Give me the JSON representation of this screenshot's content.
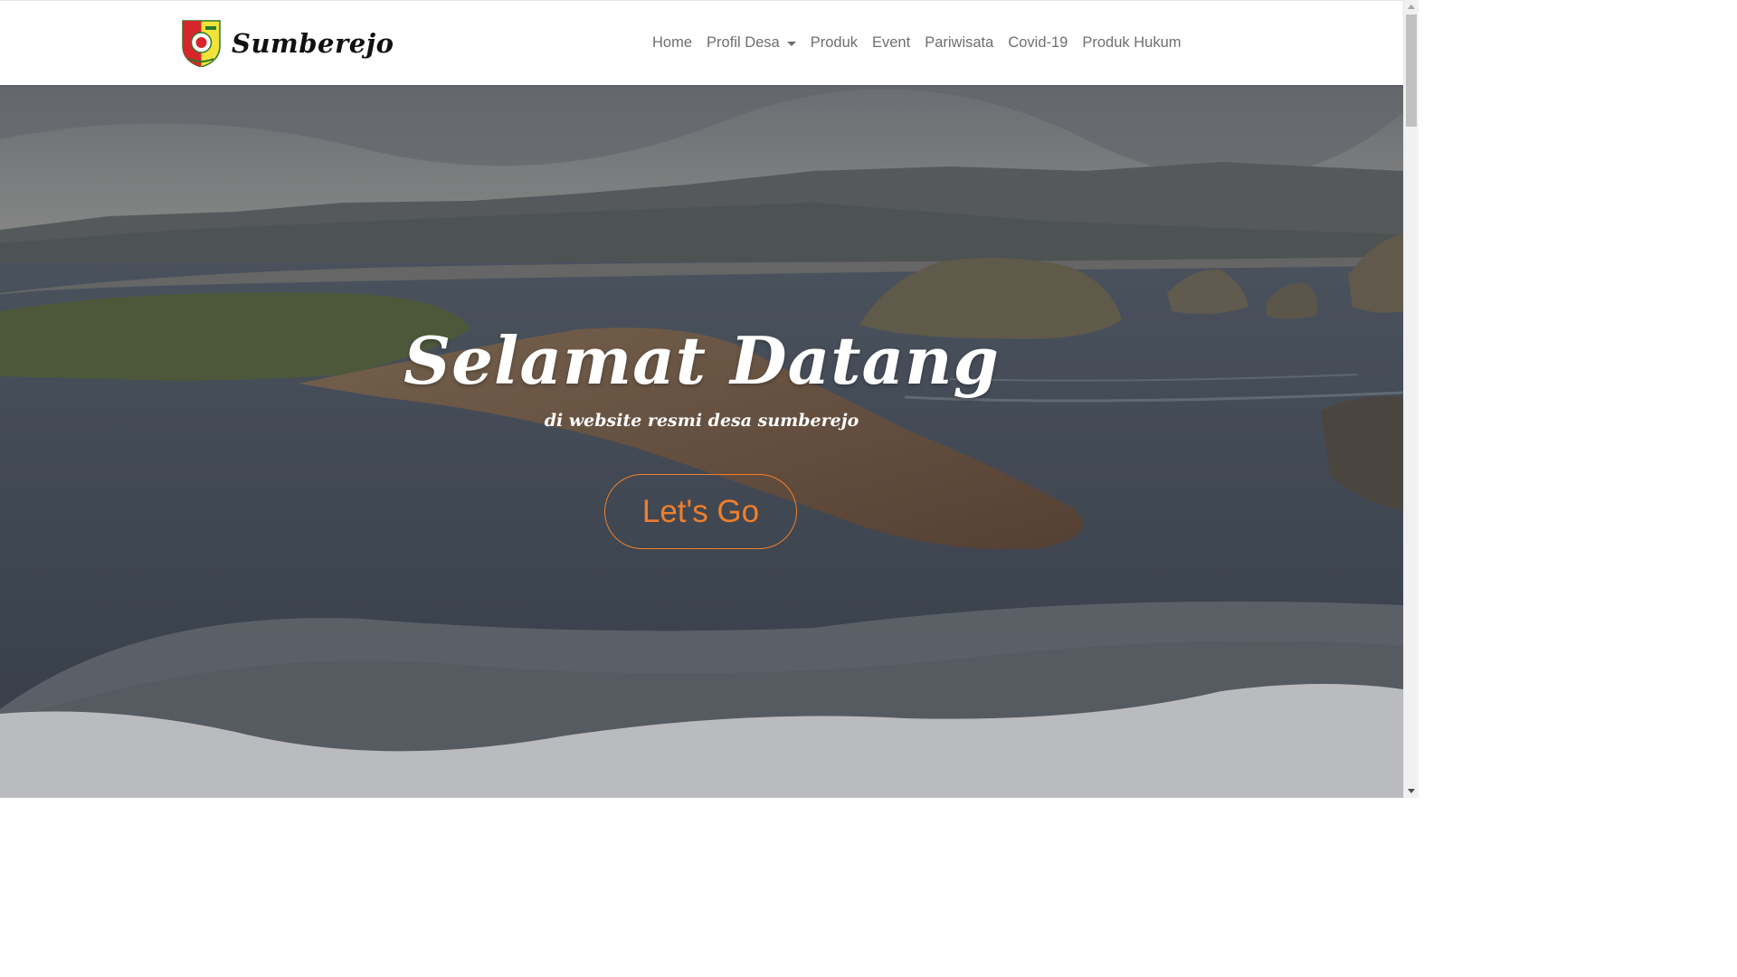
{
  "brand": {
    "name": "Sumberejo",
    "logo": "village-crest-logo"
  },
  "nav": {
    "items": [
      {
        "label": "Home"
      },
      {
        "label": "Profil Desa",
        "dropdown": true
      },
      {
        "label": "Produk"
      },
      {
        "label": "Event"
      },
      {
        "label": "Pariwisata"
      },
      {
        "label": "Covid-19"
      },
      {
        "label": "Produk Hukum"
      }
    ]
  },
  "hero": {
    "title": "Selamat Datang",
    "subtitle": "di website resmi desa sumberejo",
    "cta_label": "Let's Go",
    "background": "coastal-landscape-photo"
  },
  "colors": {
    "accent": "#ef7f2c",
    "nav_text": "#6e6e6e",
    "hero_text": "#ffffff"
  }
}
